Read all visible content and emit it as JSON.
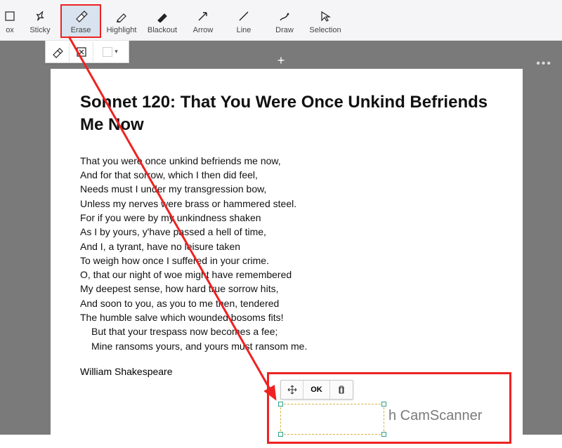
{
  "toolbar": {
    "items": [
      {
        "id": "box-partial",
        "label": "ox"
      },
      {
        "id": "sticky",
        "label": "Sticky"
      },
      {
        "id": "erase",
        "label": "Erase"
      },
      {
        "id": "highlight",
        "label": "Highlight"
      },
      {
        "id": "blackout",
        "label": "Blackout"
      },
      {
        "id": "arrow",
        "label": "Arrow"
      },
      {
        "id": "line",
        "label": "Line"
      },
      {
        "id": "draw",
        "label": "Draw"
      },
      {
        "id": "selection",
        "label": "Selection"
      }
    ]
  },
  "sub_toolbar": {
    "dropdown_caret": "▾"
  },
  "canvas": {
    "add": "+",
    "more": "•••"
  },
  "document": {
    "title": "Sonnet 120: That You Were Once Unkind Befriends Me Now",
    "lines": [
      "That you were once unkind befriends me now,",
      "And for that sorrow, which I then did feel,",
      "Needs must I under my transgression bow,",
      "Unless my nerves were brass or hammered steel.",
      "For if you were by my unkindness shaken",
      "As I by yours, y'have passed a hell of time,",
      "And I, a tyrant, have no leisure taken",
      "To weigh how once I suffered in your crime.",
      "O, that our night of woe might have remembered",
      "My deepest sense, how hard true sorrow hits,",
      "And soon to you, as you to me then, tendered",
      "The humble salve which wounded bosoms fits!",
      "But that your trespass now becomes a fee;",
      "Mine ransoms yours, and yours must ransom me."
    ],
    "author": "William Shakespeare"
  },
  "erase_popup": {
    "ok_label": "OK"
  },
  "watermark_text": "h CamScanner"
}
